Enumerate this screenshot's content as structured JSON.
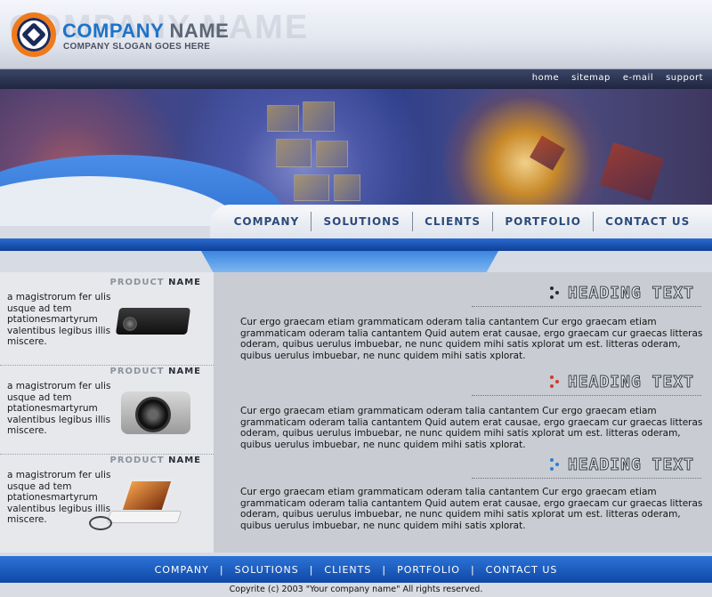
{
  "header": {
    "watermark": "COMPANY NAME",
    "company_word1": "COMPANY",
    "company_word2": "NAME",
    "slogan": "COMPANY SLOGAN GOES HERE"
  },
  "top_links": [
    "home",
    "sitemap",
    "e-mail",
    "support"
  ],
  "main_nav": [
    "COMPANY",
    "SOLUTIONS",
    "CLIENTS",
    "PORTFOLIO",
    "CONTACT US"
  ],
  "products": [
    {
      "title_light": "PRODUCT",
      "title_bold": "NAME",
      "desc": "a magistrorum fer ulis usque ad tem ptationesmartyrum valentibus legibus illis miscere."
    },
    {
      "title_light": "PRODUCT",
      "title_bold": "NAME",
      "desc": "a magistrorum fer ulis usque ad tem ptationesmartyrum valentibus legibus illis miscere."
    },
    {
      "title_light": "PRODUCT",
      "title_bold": "NAME",
      "desc": "a magistrorum fer ulis usque ad tem ptationesmartyrum valentibus legibus illis miscere."
    }
  ],
  "sections": [
    {
      "heading": "HEADING TEXT",
      "icon_color": "#2a2a2a",
      "text": "Cur ergo graecam etiam grammaticam oderam talia cantantem Cur ergo graecam etiam grammaticam oderam talia cantantem Quid autem erat causae, ergo graecam cur graecas litteras oderam, quibus uerulus imbuebar, ne nunc quidem mihi satis xplorat um est. litteras oderam, quibus uerulus imbuebar, ne nunc quidem mihi satis xplorat."
    },
    {
      "heading": "HEADING TEXT",
      "icon_color": "#d23a2a",
      "text": "Cur ergo graecam etiam grammaticam oderam talia cantantem Cur ergo graecam etiam grammaticam oderam talia cantantem Quid autem erat causae, ergo graecam cur graecas litteras oderam, quibus uerulus imbuebar, ne nunc quidem mihi satis xplorat um est. litteras oderam, quibus uerulus imbuebar, ne nunc quidem mihi satis xplorat."
    },
    {
      "heading": "HEADING TEXT",
      "icon_color": "#2a7fd6",
      "text": "Cur ergo graecam etiam grammaticam oderam talia cantantem Cur ergo graecam etiam grammaticam oderam talia cantantem Quid autem erat causae, ergo graecam cur graecas litteras oderam, quibus uerulus imbuebar, ne nunc quidem mihi satis xplorat um est. litteras oderam, quibus uerulus imbuebar, ne nunc quidem mihi satis xplorat."
    }
  ],
  "footer_nav": [
    "COMPANY",
    "SOLUTIONS",
    "CLIENTS",
    "PORTFOLIO",
    "CONTACT US"
  ],
  "copyright": "Copyrite (c) 2003 \"Your company name\" All rights reserved."
}
